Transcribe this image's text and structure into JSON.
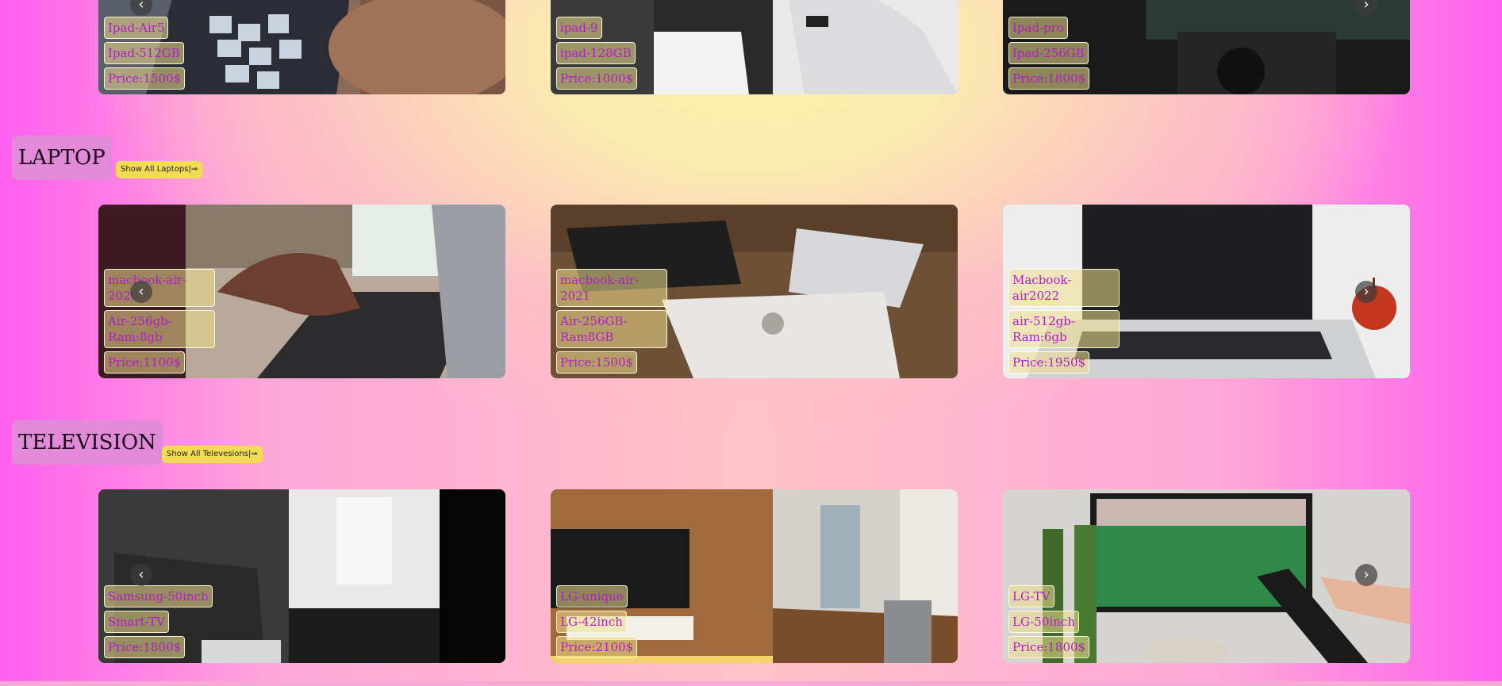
{
  "sections": {
    "tablets": {
      "cards": [
        {
          "name": "Ipad-Air5",
          "spec": "Ipad-512GB",
          "price": "Price:1500$"
        },
        {
          "name": "ipad-9",
          "spec": "ipad-128GB",
          "price": "Price:1000$"
        },
        {
          "name": "Ipad-pro",
          "spec": "Ipad-256GB",
          "price": "Price:1800$"
        }
      ]
    },
    "laptop": {
      "title": "LAPTOP",
      "show_all": "Show All Laptops|⇒",
      "cards": [
        {
          "name": "macbook-air-2020",
          "spec": "Air-256gb-Ram:8gb",
          "price": "Price:1100$"
        },
        {
          "name": "macbook-air-2021",
          "spec": "Air-256GB-Ram8GB",
          "price": "Price:1500$"
        },
        {
          "name": "Macbook-air2022",
          "spec": "air-512gb-Ram:6gb",
          "price": "Price:1950$"
        }
      ]
    },
    "television": {
      "title": "TELEVISION",
      "show_all": "Show All Televesions|⇒",
      "cards": [
        {
          "name": "Samsung-50inch",
          "spec": "Smart-TV",
          "price": "Price:1800$"
        },
        {
          "name": "LG-unique",
          "spec": "LG-42inch",
          "price": "Price:2100$"
        },
        {
          "name": "LG-TV",
          "spec": "LG-50inch",
          "price": "Price:1800$"
        }
      ]
    }
  },
  "icons": {
    "prev": "chevron-left-icon",
    "next": "chevron-right-icon"
  },
  "colors": {
    "heading_bg": "#e08ad8",
    "button_bg": "#f2dc55",
    "tag_text": "#b21cc9"
  }
}
